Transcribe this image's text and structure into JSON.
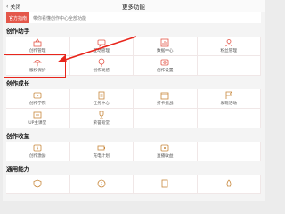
{
  "topbar": {
    "close_label": "关闭",
    "title": "更多功能"
  },
  "banner": {
    "tag": "官方指南",
    "text": "带你看懂创作中心全部功能"
  },
  "sections": [
    {
      "title": "创作助手",
      "items": [
        "创作管理",
        "互动管理",
        "数据中心",
        "粉丝管理",
        "版权保护",
        "创作灵感",
        "创作设置",
        ""
      ]
    },
    {
      "title": "创作成长",
      "items": [
        "创作学院",
        "任务中心",
        "打卡挑战",
        "发现活动",
        "UP主课堂",
        "荣誉殿堂",
        "",
        ""
      ]
    },
    {
      "title": "创作收益",
      "items": [
        "创作激励",
        "充电计划",
        "直播收益",
        ""
      ]
    },
    {
      "title": "通用能力",
      "items": [
        "",
        "",
        "",
        ""
      ]
    }
  ],
  "colors": {
    "accent": "#e4574a",
    "highlight": "#e8261c"
  }
}
